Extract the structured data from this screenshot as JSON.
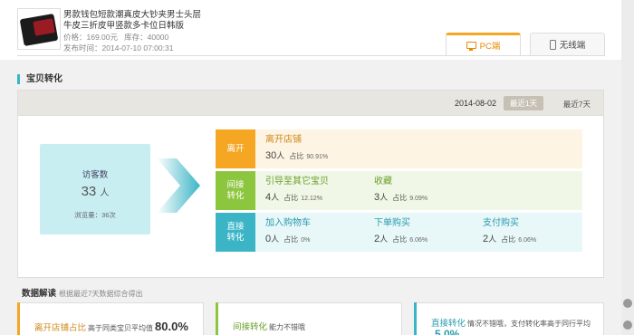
{
  "product": {
    "title": "男款钱包短款潮真皮大钞夹男士头层牛皮三折皮甲竖款多卡位日韩版",
    "price_label": "价格：",
    "price": "169.00元",
    "stock_label": "库存：",
    "stock": "40000",
    "publish_label": "发布时间：",
    "publish_time": "2014-07-10 07:00:31"
  },
  "tabs": [
    {
      "label": "PC端",
      "icon": "monitor-icon",
      "active": true
    },
    {
      "label": "无线端",
      "icon": "phone-icon",
      "active": false
    }
  ],
  "section_title": "宝贝转化",
  "panel": {
    "date": "2014-08-02",
    "day_button": "最近1天",
    "week_button": "最近7天"
  },
  "visitor": {
    "label": "访客数",
    "count": "33",
    "unit": "人",
    "pv": "浏览量：36次"
  },
  "funnel": {
    "leave": {
      "tag": "离开",
      "items": [
        {
          "title": "离开店铺",
          "value": "30",
          "unit": "人",
          "pct_label": "占比",
          "pct": "90.91%"
        }
      ]
    },
    "indirect": {
      "tag": "间接\n转化",
      "items": [
        {
          "title": "引导至其它宝贝",
          "value": "4",
          "unit": "人",
          "pct_label": "占比",
          "pct": "12.12%"
        },
        {
          "title": "收藏",
          "value": "3",
          "unit": "人",
          "pct_label": "占比",
          "pct": "9.09%"
        }
      ]
    },
    "direct": {
      "tag": "直接\n转化",
      "items": [
        {
          "title": "加入购物车",
          "value": "0",
          "unit": "人",
          "pct_label": "占比",
          "pct": "0%"
        },
        {
          "title": "下单购买",
          "value": "2",
          "unit": "人",
          "pct_label": "占比",
          "pct": "6.06%"
        },
        {
          "title": "支付购买",
          "value": "2",
          "unit": "人",
          "pct_label": "占比",
          "pct": "6.06%"
        }
      ]
    }
  },
  "analysis": {
    "title": "数据解读",
    "note": "根据最近7天数据综合得出",
    "cards": [
      {
        "head": "离开店铺占比",
        "sub": "高于同类宝贝平均值",
        "big": "80.0%"
      },
      {
        "head": "间接转化",
        "sub": "能力不错哦"
      },
      {
        "head": "直接转化",
        "sub": "情况不错哦，支付转化率高于同行平均",
        "big": "5.0%"
      }
    ]
  },
  "colors": {
    "leave": "#f5a623",
    "indirect": "#8cc63e",
    "direct": "#3bb5c6"
  }
}
